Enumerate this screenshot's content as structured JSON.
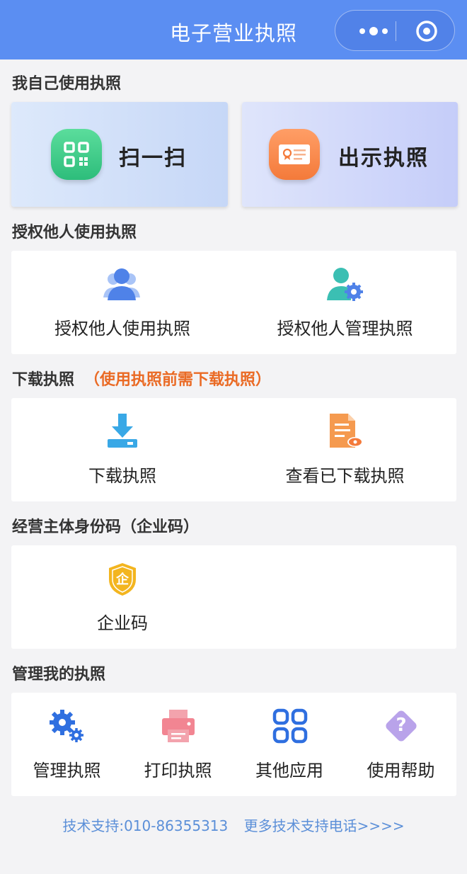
{
  "header": {
    "title": "电子营业执照"
  },
  "sections": {
    "self_use": "我自己使用执照",
    "authorize": "授权他人使用执照",
    "download": "下载执照",
    "download_note": "（使用执照前需下载执照）",
    "entity_code": "经营主体身份码（企业码）",
    "manage": "管理我的执照"
  },
  "quick": {
    "scan": "扫一扫",
    "show": "出示执照"
  },
  "authorize_items": {
    "use": "授权他人使用执照",
    "manage": "授权他人管理执照"
  },
  "download_items": {
    "download": "下载执照",
    "view": "查看已下载执照"
  },
  "entity_items": {
    "code": "企业码",
    "code_glyph": "企"
  },
  "manage_items": {
    "manage": "管理执照",
    "print": "打印执照",
    "other": "其他应用",
    "help": "使用帮助",
    "help_glyph": "?"
  },
  "footer": {
    "support": "技术支持:010-86355313",
    "more": "更多技术支持电话>>>>"
  },
  "colors": {
    "header": "#5b8ef2",
    "accent": "#ea6a24",
    "link": "#5b8fd8"
  }
}
